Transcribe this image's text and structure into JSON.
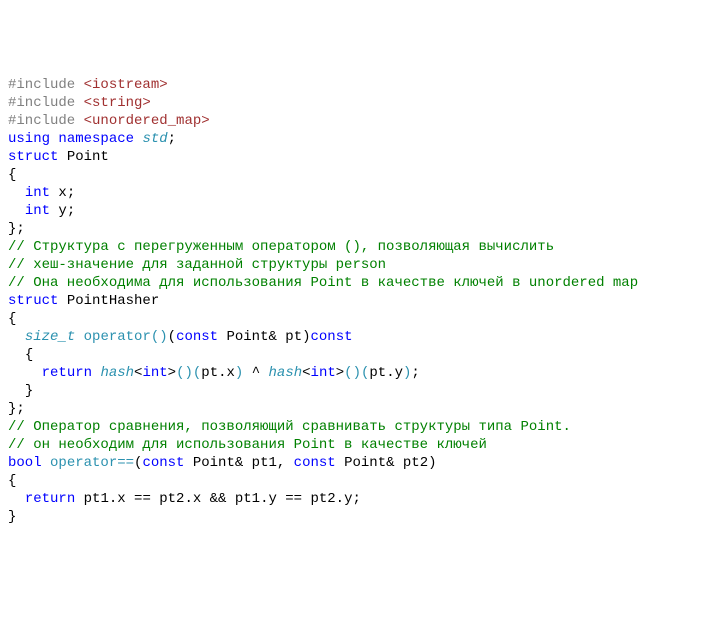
{
  "code": {
    "lines": [
      {
        "tokens": [
          {
            "cls": "tok-preproc",
            "t": "#include "
          },
          {
            "cls": "tok-string",
            "t": "<iostream>"
          }
        ]
      },
      {
        "tokens": [
          {
            "cls": "tok-preproc",
            "t": "#include "
          },
          {
            "cls": "tok-string",
            "t": "<string>"
          }
        ]
      },
      {
        "tokens": [
          {
            "cls": "tok-preproc",
            "t": "#include "
          },
          {
            "cls": "tok-string",
            "t": "<unordered_map>"
          }
        ]
      },
      {
        "tokens": [
          {
            "cls": "tok-keyword",
            "t": "using"
          },
          {
            "cls": "tok-ident",
            "t": " "
          },
          {
            "cls": "tok-keyword",
            "t": "namespace"
          },
          {
            "cls": "tok-ident",
            "t": " "
          },
          {
            "cls": "tok-type",
            "t": "std"
          },
          {
            "cls": "tok-punct",
            "t": ";"
          }
        ]
      },
      {
        "tokens": [
          {
            "cls": "tok-ident",
            "t": ""
          }
        ]
      },
      {
        "tokens": [
          {
            "cls": "tok-keyword",
            "t": "struct"
          },
          {
            "cls": "tok-ident",
            "t": " Point"
          }
        ]
      },
      {
        "tokens": [
          {
            "cls": "tok-punct",
            "t": "{"
          }
        ]
      },
      {
        "tokens": [
          {
            "cls": "tok-ident",
            "t": "  "
          },
          {
            "cls": "tok-keyword",
            "t": "int"
          },
          {
            "cls": "tok-ident",
            "t": " x;"
          }
        ]
      },
      {
        "tokens": [
          {
            "cls": "tok-ident",
            "t": "  "
          },
          {
            "cls": "tok-keyword",
            "t": "int"
          },
          {
            "cls": "tok-ident",
            "t": " y;"
          }
        ]
      },
      {
        "tokens": [
          {
            "cls": "tok-punct",
            "t": "};"
          }
        ]
      },
      {
        "tokens": [
          {
            "cls": "tok-ident",
            "t": ""
          }
        ]
      },
      {
        "tokens": [
          {
            "cls": "tok-comment",
            "t": "// Структура с перегруженным оператором (), позволяющая вычислить"
          }
        ]
      },
      {
        "tokens": [
          {
            "cls": "tok-comment",
            "t": "// хеш-значение для заданной структуры person"
          }
        ]
      },
      {
        "tokens": [
          {
            "cls": "tok-comment",
            "t": "// Она необходима для использования Point в качестве ключей в unordered map"
          }
        ]
      },
      {
        "tokens": [
          {
            "cls": "tok-keyword",
            "t": "struct"
          },
          {
            "cls": "tok-ident",
            "t": " PointHasher"
          }
        ]
      },
      {
        "tokens": [
          {
            "cls": "tok-punct",
            "t": "{"
          }
        ]
      },
      {
        "tokens": [
          {
            "cls": "tok-ident",
            "t": "  "
          },
          {
            "cls": "tok-type",
            "t": "size_t"
          },
          {
            "cls": "tok-ident",
            "t": " "
          },
          {
            "cls": "tok-func",
            "t": "operator()"
          },
          {
            "cls": "tok-punct",
            "t": "("
          },
          {
            "cls": "tok-keyword",
            "t": "const"
          },
          {
            "cls": "tok-ident",
            "t": " Point& pt"
          },
          {
            "cls": "tok-punct",
            "t": ")"
          },
          {
            "cls": "tok-keyword",
            "t": "const"
          }
        ]
      },
      {
        "tokens": [
          {
            "cls": "tok-ident",
            "t": "  "
          },
          {
            "cls": "tok-punct",
            "t": "{"
          }
        ]
      },
      {
        "tokens": [
          {
            "cls": "tok-ident",
            "t": "    "
          },
          {
            "cls": "tok-keyword",
            "t": "return"
          },
          {
            "cls": "tok-ident",
            "t": " "
          },
          {
            "cls": "tok-type",
            "t": "hash"
          },
          {
            "cls": "tok-punct",
            "t": "<"
          },
          {
            "cls": "tok-keyword",
            "t": "int"
          },
          {
            "cls": "tok-punct",
            "t": ">"
          },
          {
            "cls": "tok-paren",
            "t": "()("
          },
          {
            "cls": "tok-ident",
            "t": "pt.x"
          },
          {
            "cls": "tok-paren",
            "t": ")"
          },
          {
            "cls": "tok-ident",
            "t": " ^ "
          },
          {
            "cls": "tok-type",
            "t": "hash"
          },
          {
            "cls": "tok-punct",
            "t": "<"
          },
          {
            "cls": "tok-keyword",
            "t": "int"
          },
          {
            "cls": "tok-punct",
            "t": ">"
          },
          {
            "cls": "tok-paren",
            "t": "()("
          },
          {
            "cls": "tok-ident",
            "t": "pt.y"
          },
          {
            "cls": "tok-paren",
            "t": ")"
          },
          {
            "cls": "tok-punct",
            "t": ";"
          }
        ]
      },
      {
        "tokens": [
          {
            "cls": "tok-ident",
            "t": "  "
          },
          {
            "cls": "tok-punct",
            "t": "}"
          }
        ]
      },
      {
        "tokens": [
          {
            "cls": "tok-punct",
            "t": "};"
          }
        ]
      },
      {
        "tokens": [
          {
            "cls": "tok-ident",
            "t": ""
          }
        ]
      },
      {
        "tokens": [
          {
            "cls": "tok-comment",
            "t": "// Оператор сравнения, позволяющий сравнивать структуры типа Point."
          }
        ]
      },
      {
        "tokens": [
          {
            "cls": "tok-comment",
            "t": "// он необходим для использования Point в качестве ключей"
          }
        ]
      },
      {
        "tokens": [
          {
            "cls": "tok-keyword",
            "t": "bool"
          },
          {
            "cls": "tok-ident",
            "t": " "
          },
          {
            "cls": "tok-func",
            "t": "operator=="
          },
          {
            "cls": "tok-punct",
            "t": "("
          },
          {
            "cls": "tok-keyword",
            "t": "const"
          },
          {
            "cls": "tok-ident",
            "t": " Point& pt1, "
          },
          {
            "cls": "tok-keyword",
            "t": "const"
          },
          {
            "cls": "tok-ident",
            "t": " Point& pt2"
          },
          {
            "cls": "tok-punct",
            "t": ")"
          }
        ]
      },
      {
        "tokens": [
          {
            "cls": "tok-punct",
            "t": "{"
          }
        ]
      },
      {
        "tokens": [
          {
            "cls": "tok-ident",
            "t": "  "
          },
          {
            "cls": "tok-keyword",
            "t": "return"
          },
          {
            "cls": "tok-ident",
            "t": " pt1.x == pt2.x && pt1.y == pt2.y;"
          }
        ]
      },
      {
        "tokens": [
          {
            "cls": "tok-punct",
            "t": "}"
          }
        ]
      }
    ]
  }
}
